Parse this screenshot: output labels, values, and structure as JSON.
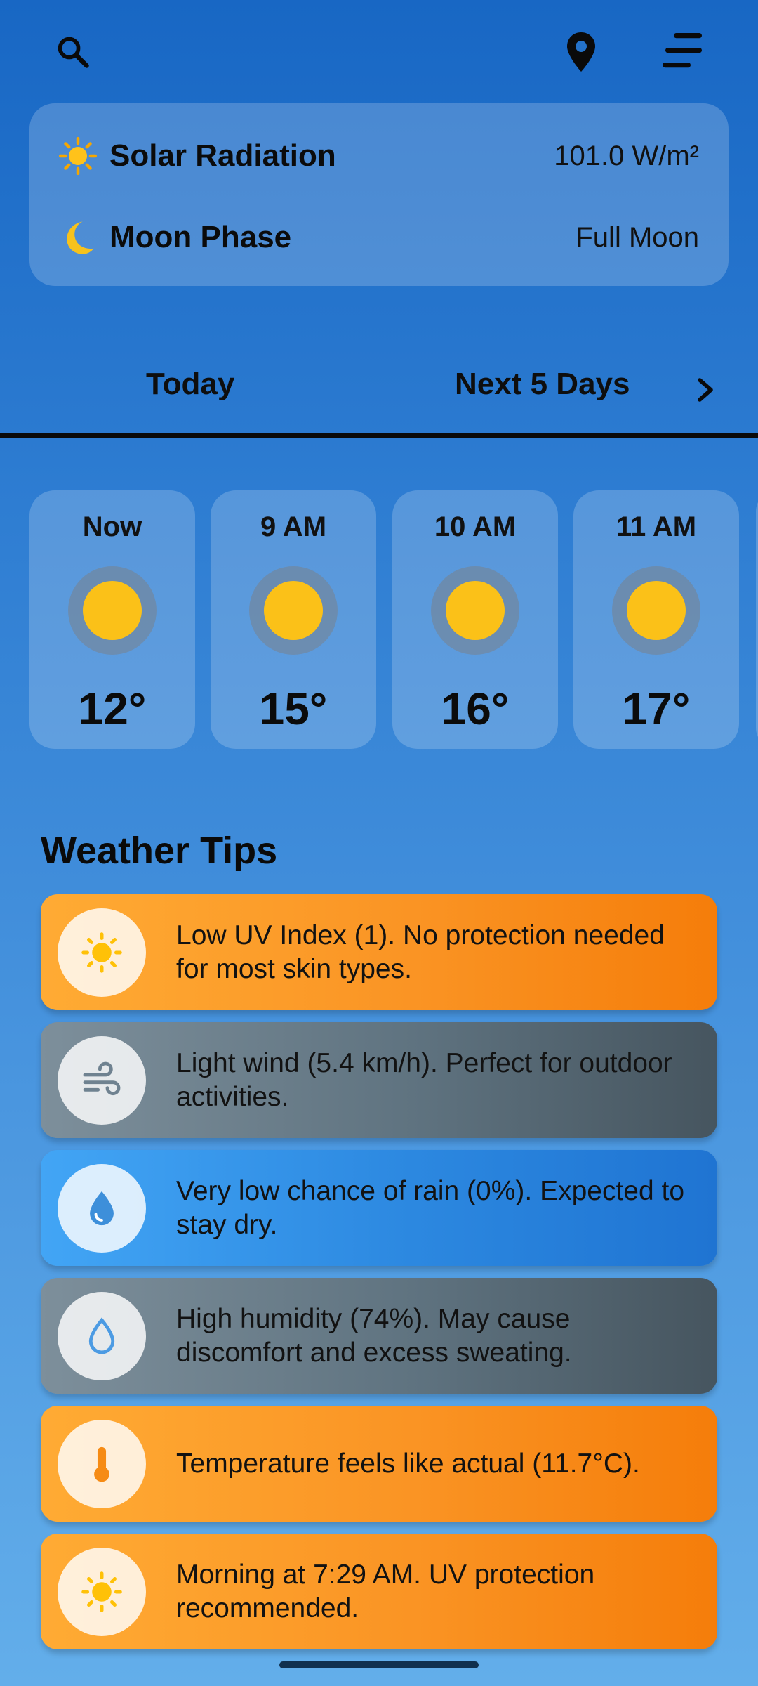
{
  "header": {
    "icons": [
      "search-icon",
      "location-pin-icon",
      "menu-icon"
    ]
  },
  "info_card": {
    "solar": {
      "icon": "sun-emoji",
      "label": "Solar Radiation",
      "value": "101.0 W/m²"
    },
    "moon": {
      "icon": "crescent-moon-emoji",
      "label": "Moon Phase",
      "value": "Full Moon"
    }
  },
  "tabs": {
    "today": "Today",
    "next_days": "Next 5 Days",
    "chevron_icon": "chevron-right-icon"
  },
  "hourly": [
    {
      "time": "Now",
      "temp": "12°",
      "icon": "sun-icon"
    },
    {
      "time": "9 AM",
      "temp": "15°",
      "icon": "sun-icon"
    },
    {
      "time": "10 AM",
      "temp": "16°",
      "icon": "sun-icon"
    },
    {
      "time": "11 AM",
      "temp": "17°",
      "icon": "sun-icon"
    }
  ],
  "tips_section": {
    "title": "Weather Tips",
    "tips": [
      {
        "icon": "sun-icon",
        "text": "Low UV Index (1). No protection needed for most skin types.",
        "color": "#F88A18"
      },
      {
        "icon": "wind-icon",
        "text": "Light wind (5.4 km/h). Perfect for outdoor activities.",
        "color": "#5F7380"
      },
      {
        "icon": "raindrop-icon",
        "text": "Very low chance of rain (0%). Expected to stay dry.",
        "color": "#2C88E0"
      },
      {
        "icon": "humidity-drop-icon",
        "text": "High humidity (74%). May cause discomfort and excess sweating.",
        "color": "#5F7380"
      },
      {
        "icon": "thermometer-icon",
        "text": "Temperature feels like actual (11.7°C).",
        "color": "#F88A18"
      },
      {
        "icon": "sun-icon",
        "text": "Morning at 7:29 AM. UV protection recommended.",
        "color": "#F88A18"
      }
    ]
  }
}
